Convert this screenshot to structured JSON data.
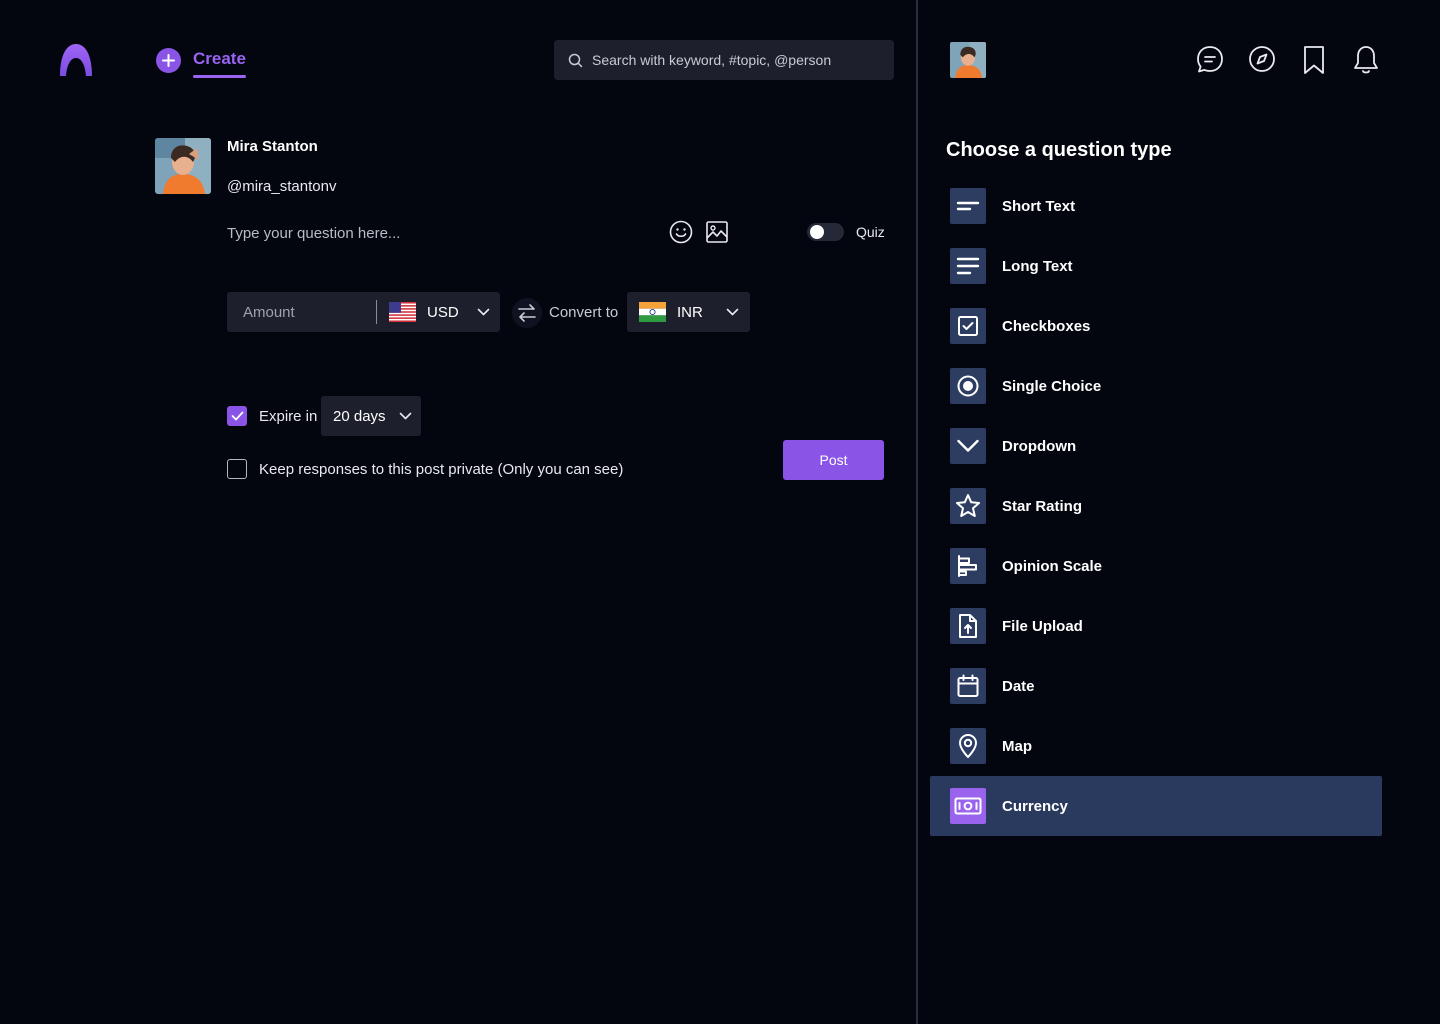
{
  "header": {
    "create_label": "Create",
    "search_placeholder": "Search with keyword, #topic, @person"
  },
  "user": {
    "name": "Mira Stanton",
    "handle": "@mira_stantonv"
  },
  "composer": {
    "question_placeholder": "Type your question here...",
    "quiz_label": "Quiz",
    "quiz_enabled": false
  },
  "currency": {
    "amount_placeholder": "Amount",
    "from_code": "USD",
    "from_flag": "us-flag-icon",
    "convert_label": "Convert to",
    "to_code": "INR",
    "to_flag": "india-flag-icon"
  },
  "options": {
    "expire_checked": true,
    "expire_label": "Expire in",
    "expire_value": "20 days",
    "private_checked": false,
    "private_label": "Keep responses to this post private (Only you can see)",
    "post_label": "Post"
  },
  "question_types": {
    "title": "Choose  a question type",
    "selected": "Currency",
    "items": [
      {
        "label": "Short Text",
        "icon": "short-text-icon"
      },
      {
        "label": "Long Text",
        "icon": "long-text-icon"
      },
      {
        "label": "Checkboxes",
        "icon": "checkbox-icon"
      },
      {
        "label": "Single Choice",
        "icon": "radio-icon"
      },
      {
        "label": "Dropdown",
        "icon": "chevron-down-icon"
      },
      {
        "label": "Star Rating",
        "icon": "star-icon"
      },
      {
        "label": "Opinion Scale",
        "icon": "scale-icon"
      },
      {
        "label": "File Upload",
        "icon": "file-upload-icon"
      },
      {
        "label": "Date",
        "icon": "calendar-icon"
      },
      {
        "label": "Map",
        "icon": "map-pin-icon"
      },
      {
        "label": "Currency",
        "icon": "currency-icon"
      }
    ]
  },
  "colors": {
    "background": "#03050f",
    "accent": "#8a55e6",
    "input_bg": "#1d202c",
    "icon_tile": "#2d3d62",
    "selected_row": "#2a3a5e"
  }
}
